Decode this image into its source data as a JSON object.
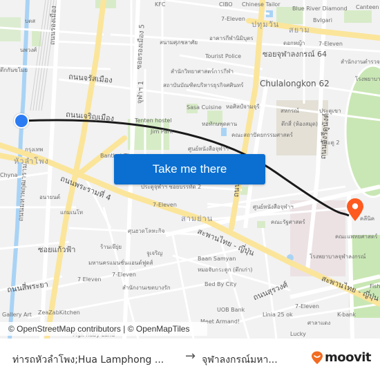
{
  "map": {
    "labels": {
      "kfc": "KFC",
      "cibo": "CIBO",
      "chinese_tailor": "Chinese Tailor",
      "blue_river": "Blue River Diamond",
      "canteen": "Canteen",
      "seven_top": "7-Eleven",
      "pathumwan": "ปทุมวัน",
      "siam": "สยาม",
      "bvlgari": "Bvlgari",
      "dokya": "ดอกหญ้า",
      "seven_top_right": "7-Eleven",
      "soi_chula_64": "ซอยจุฬาลงกรณ์ 64",
      "office_right": "สำนักงานตำรวจแห่ง",
      "chula_62": "Chulalongkon 62",
      "hospital_top": "โรงพยาบาล",
      "stadium": "สนามศุภชลาศัย",
      "building_top": "อาคารกีฬานิมิบุตร",
      "tourist_police": "Tourist Police",
      "sports_science": "สำนักวิทยาศาสตร์การกีฬา",
      "institute": "สถาบันบัณฑิตบริหารธุรกิจศศินทร์",
      "sasa": "Sasa Cuisine",
      "art_gallery": "หอศิลป์จามจุรี",
      "sahakorn": "สหกรณ์",
      "gate": "ประตูเขา",
      "building4": "ตึกสี่ (ห้องสมุด)",
      "library": "หอทักษพุดตาน",
      "faculty_acc": "คณะสถาปัตยกรรมศาสตร์",
      "gate2": "ประตู 2",
      "tenten": "Tenten hostel",
      "park": "Jim Park",
      "center": "ศูนย์หนังสือจุฬาฯ",
      "bantong": "Banthat Thong",
      "gate_road": "ประตูจุฬาฯ ซอยบรรทัด 2",
      "seven_mid": "7-Eleven",
      "samyan": "สามย่าน",
      "chula_book": "ศูนย์หนังสือจุฬาฯ",
      "political": "คณะรัฐศาสตร์",
      "clinic": "คลีนิค",
      "medicine": "คณะแพทยศาสตร์",
      "chula_hospital": "โรงพยาบาลจุฬาลงกรณ์",
      "sunhat": "ศุนฮวดโลหะกิจ",
      "ranjai": "ร้านเจ๊ยุ่ย",
      "chujarin": "จูเจริญ",
      "mahanakorn": "มหานครแมนชั่นแอนด์ฟูดส์",
      "baan_samyan": "Baan Samyan",
      "bone_doc": "หมอจับกระดูก (ตึกเก่า)",
      "seven_low": "7 Eleven",
      "seven_low2": "7-Eleven",
      "office_bangrak": "สำนักงานเขตบางรัก",
      "bed_by_city": "Bed By City",
      "uob": "UOB Bank",
      "meet_armand": "Meet Armand!",
      "linia": "Linia 25 ok",
      "seven_br": "7-Eleven",
      "kbank": "K-bank",
      "salaadaeng": "ศาลาแดง",
      "fish": "Fish",
      "gallery_art": "Gallery Art",
      "zeazab": "ZeaZabKitchen",
      "hua_lamphong": "หัวลำโพง",
      "krungthep": "กรุงเทพ",
      "chyna": "Chyna",
      "anayon": "อนายนต์",
      "kaemneo": "แกมเนโท",
      "bangkok": "บตส",
      "nawong": "นพวงศ์",
      "kanchanakit": "ตึกกันขโมย",
      "road_charoen_mueang": "ถนนจรัสเมือง",
      "road_charoen_mueang2": "ถนนเจริญเมือง",
      "road_rama4": "ถนนพระรามที่ 4",
      "road_soi_kaewfa": "ซอยแก้วฟ้า",
      "road_si_phraya": "ถนนสี่พระยา",
      "road_thai_japan": "สะพานไทย - ญี่ปุ่น",
      "road_thai_japan2": "สะพานไทย - ญี่ปุ่น",
      "road_surawong": "ถนนสุรวงศ์",
      "road_henri_dunant": "ถนนอังรีดูนังต์",
      "road_phayathai": "ถนนพญาไท",
      "road_rong_mueang": "ซอยรองเมือง 5",
      "road_chula1": "จุฬาฯ 1",
      "road_rong_mueang_main": "ถนนรองเมือง",
      "road_mahaphruettaram": "ถนนมหาพฤฒาราม",
      "lucky": "Lucky",
      "mgk": "Mgk Ruby Land"
    },
    "cta_label": "Take me there",
    "attribution": {
      "osm": "© OpenStreetMap contributors",
      "sep": " | ",
      "omt": "© OpenMapTiles"
    },
    "colors": {
      "route": "#1a1a1a",
      "origin": "#2b7cf3",
      "destination": "#ff5a1f",
      "cta": "#0a6fd1",
      "major_road": "#fbe59a",
      "park": "#c9e7b4",
      "water": "#a9d3f5"
    }
  },
  "footer": {
    "from": "ท่ารถหัวลำโพง;Hua Lamphong ...",
    "arrow": "→",
    "to": "จุฬาลงกรณ์มหา...",
    "logo_word": "moovit",
    "logo_color": "#f26b21"
  }
}
